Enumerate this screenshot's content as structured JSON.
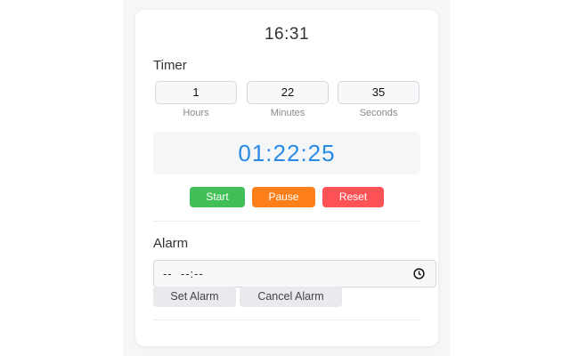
{
  "clock": "16:31",
  "timer": {
    "title": "Timer",
    "hours": {
      "value": "1",
      "label": "Hours"
    },
    "minutes": {
      "value": "22",
      "label": "Minutes"
    },
    "seconds": {
      "value": "35",
      "label": "Seconds"
    },
    "display": "01:22:25",
    "start_label": "Start",
    "pause_label": "Pause",
    "reset_label": "Reset"
  },
  "alarm": {
    "title": "Alarm",
    "time_value": "--  --:--",
    "set_label": "Set Alarm",
    "cancel_label": "Cancel Alarm"
  },
  "colors": {
    "start": "#3fbf55",
    "pause": "#fd7f1a",
    "reset": "#fd5256",
    "display": "#2b8ae6"
  }
}
